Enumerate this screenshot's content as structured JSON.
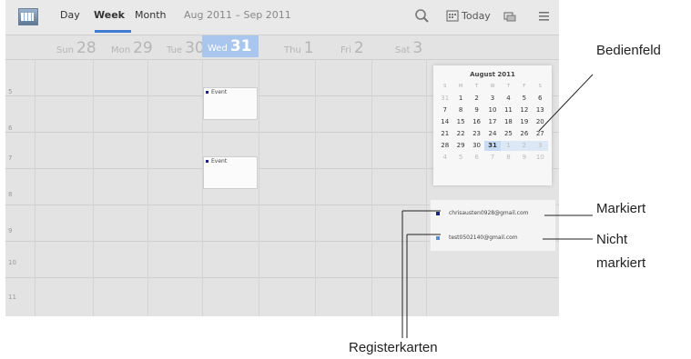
{
  "topbar": {
    "tabs": [
      {
        "label": "Day",
        "active": false
      },
      {
        "label": "Week",
        "active": true
      },
      {
        "label": "Month",
        "active": false
      }
    ],
    "date_range": "Aug 2011 – Sep 2011",
    "today_label": "Today",
    "icons": [
      "calendar-app-icon",
      "search-icon",
      "today-calendar-icon",
      "calendars-icon",
      "menu-icon"
    ]
  },
  "days": [
    {
      "name": "Sun",
      "num": "28"
    },
    {
      "name": "Mon",
      "num": "29"
    },
    {
      "name": "Tue",
      "num": "30"
    },
    {
      "name": "Wed",
      "num": "31"
    },
    {
      "name": "Thu",
      "num": "1"
    },
    {
      "name": "Fri",
      "num": "2"
    },
    {
      "name": "Sat",
      "num": "3"
    }
  ],
  "hours": [
    "5",
    "6",
    "7",
    "8",
    "9",
    "10",
    "11"
  ],
  "events": [
    {
      "label": "Event"
    },
    {
      "label": "Event"
    }
  ],
  "mini_calendar": {
    "title": "August 2011",
    "dow": [
      "S",
      "M",
      "T",
      "W",
      "T",
      "F",
      "S"
    ],
    "weeks": [
      [
        "31",
        "1",
        "2",
        "3",
        "4",
        "5",
        "6"
      ],
      [
        "7",
        "8",
        "9",
        "10",
        "11",
        "12",
        "13"
      ],
      [
        "14",
        "15",
        "16",
        "17",
        "18",
        "19",
        "20"
      ],
      [
        "21",
        "22",
        "23",
        "24",
        "25",
        "26",
        "27"
      ],
      [
        "28",
        "29",
        "30",
        "31",
        "1",
        "2",
        "3"
      ],
      [
        "4",
        "5",
        "6",
        "7",
        "8",
        "9",
        "10"
      ]
    ]
  },
  "accounts": [
    {
      "email": "chrisausten0928@gmail.com",
      "color": "#1a237e"
    },
    {
      "email": "test0502140@gmail.com",
      "color": "#5c8ad6"
    }
  ],
  "callouts": {
    "bedienfeld": "Bedienfeld",
    "markiert": "Markiert",
    "nicht_markiert_1": "Nicht",
    "nicht_markiert_2": "markiert",
    "registerkarten": "Registerkarten"
  }
}
